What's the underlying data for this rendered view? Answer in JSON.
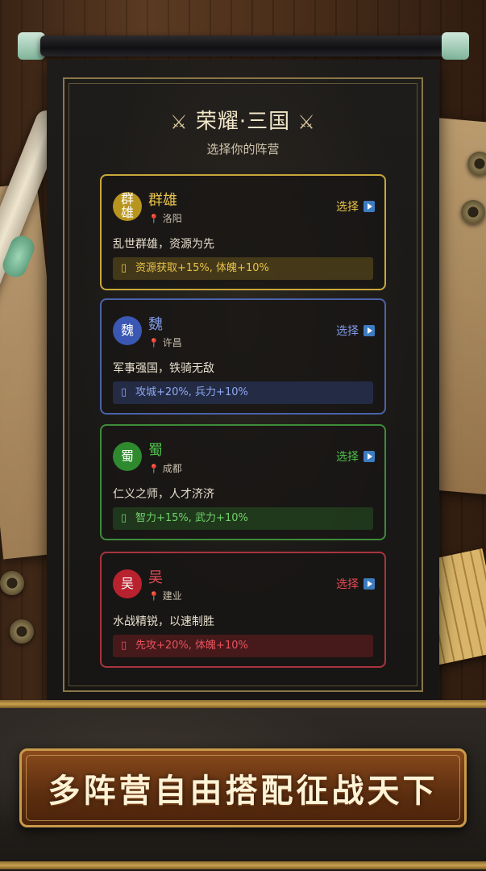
{
  "header": {
    "title": "荣耀·三国",
    "subtitle": "选择你的阵营",
    "title_icon": "crossed-swords-icon"
  },
  "factions": [
    {
      "id": "qunxiong",
      "avatar_text": "群\n雄",
      "name": "群雄",
      "location": "洛阳",
      "select_label": "选择",
      "description": "乱世群雄，资源为先",
      "buff": "资源获取+15%, 体魄+10%",
      "color": "#e8c24a"
    },
    {
      "id": "wei",
      "avatar_text": "魏",
      "name": "魏",
      "location": "许昌",
      "select_label": "选择",
      "description": "军事强国，铁骑无敌",
      "buff": "攻城+20%, 兵力+10%",
      "color": "#7f9ae8"
    },
    {
      "id": "shu",
      "avatar_text": "蜀",
      "name": "蜀",
      "location": "成都",
      "select_label": "选择",
      "description": "仁义之师，人才济济",
      "buff": "智力+15%, 武力+10%",
      "color": "#4fbf4a"
    },
    {
      "id": "wu",
      "avatar_text": "吴",
      "name": "吴",
      "location": "建业",
      "select_label": "选择",
      "description": "水战精锐，以速制胜",
      "buff": "先攻+20%, 体魄+10%",
      "color": "#e24a55"
    }
  ],
  "banner": {
    "slogan": "多阵营自由搭配征战天下"
  }
}
